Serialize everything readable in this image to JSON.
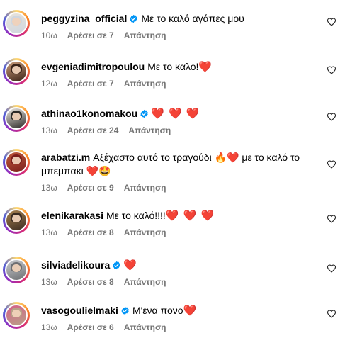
{
  "comments": [
    {
      "username": "peggyzina_official",
      "verified": true,
      "text": "Με το καλό αγάπες μου",
      "emoji": "",
      "time": "10ω",
      "likes": "Αρέσει σε 7",
      "reply": "Απάντηση",
      "avatar_colors": [
        "#cfd6df",
        "#e8e3da"
      ]
    },
    {
      "username": "evgeniadimitropoulou",
      "verified": false,
      "text": "Με το καλο!",
      "emoji": "❤️",
      "time": "12ω",
      "likes": "Αρέσει σε 7",
      "reply": "Απάντηση",
      "avatar_colors": [
        "#3a2318",
        "#cc9c7a"
      ]
    },
    {
      "username": "athinao1konomakou",
      "verified": true,
      "text": "",
      "emoji": "❤️ ❤️ ❤️",
      "time": "13ω",
      "likes": "Αρέσει σε 24",
      "reply": "Απάντηση",
      "avatar_colors": [
        "#2c2a28",
        "#ece7e1"
      ]
    },
    {
      "username": "arabatzi.m",
      "verified": false,
      "text": "Αξέχαστο αυτό το τραγούδι 🔥❤️ με το καλό το μπεμπακι ❤️🤩",
      "emoji": "",
      "time": "13ω",
      "likes": "Αρέσει σε 9",
      "reply": "Απάντηση",
      "avatar_colors": [
        "#7b1e1b",
        "#c05a3c"
      ]
    },
    {
      "username": "elenikarakasi",
      "verified": false,
      "text": "Με το καλό!!!!",
      "emoji": "❤️ ❤️ ❤️",
      "time": "13ω",
      "likes": "Αρέσει σε 8",
      "reply": "Απάντηση",
      "avatar_colors": [
        "#3b2c22",
        "#a7804e"
      ]
    },
    {
      "username": "silviadelikoura",
      "verified": true,
      "text": "",
      "emoji": "❤️",
      "time": "13ω",
      "likes": "Αρέσει σε 8",
      "reply": "Απάντηση",
      "avatar_colors": [
        "#6d6f72",
        "#c9cbcf"
      ]
    },
    {
      "username": "vasogoulielmaki",
      "verified": true,
      "text": "Μ'ενα πονο",
      "emoji": "❤️",
      "time": "13ω",
      "likes": "Αρέσει σε 6",
      "reply": "Απάντηση",
      "avatar_colors": [
        "#b8a188",
        "#d55f88"
      ]
    }
  ],
  "icons": {
    "like": "heart-outline-icon",
    "verified": "verified-badge-icon"
  },
  "colors": {
    "meta": "#737373",
    "verified": "#0095f6",
    "heart": "#e0162b"
  }
}
